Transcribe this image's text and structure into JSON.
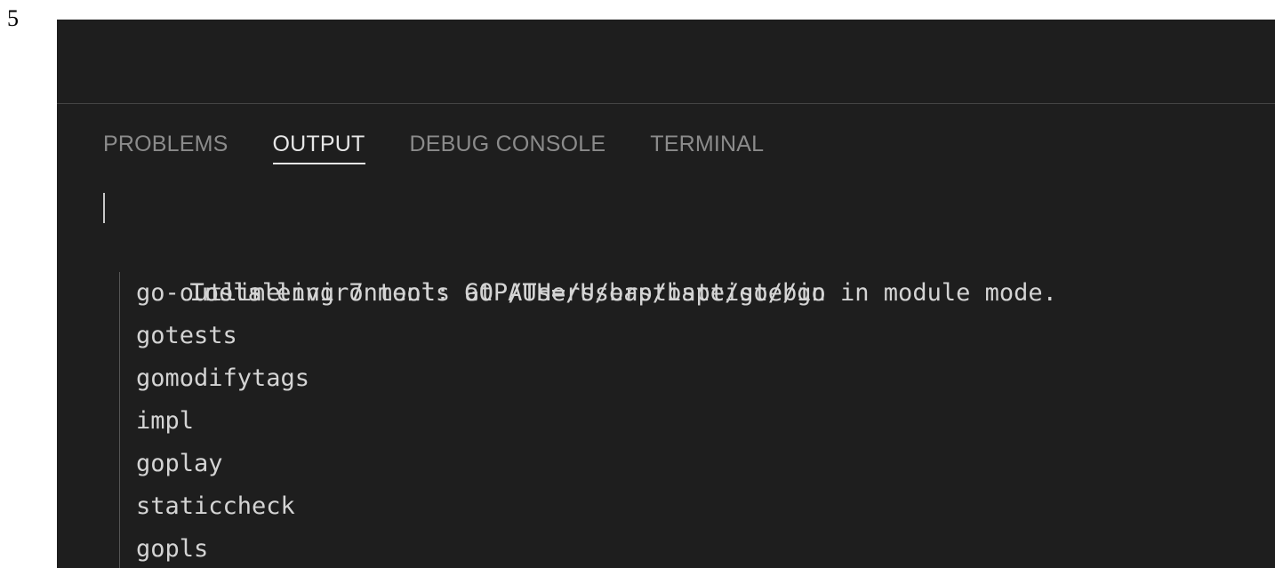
{
  "page_number": "5",
  "tabs": [
    {
      "label": "PROBLEMS",
      "active": false
    },
    {
      "label": "OUTPUT",
      "active": true
    },
    {
      "label": "DEBUG CONSOLE",
      "active": false
    },
    {
      "label": "TERMINAL",
      "active": false
    }
  ],
  "output": {
    "line1": "Tools environment: GOPATH=/Users/baptiste/go",
    "line2": "Installing 7 tools at /Users/baptiste/go/bin in module mode.",
    "tools": [
      "go-outline",
      "gotests",
      "gomodifytags",
      "impl",
      "goplay",
      "staticcheck",
      "gopls"
    ]
  },
  "colors": {
    "panel_background": "#1e1e1e",
    "active_tab": "#e7e7e7",
    "inactive_tab": "#8b8b8b",
    "text": "#d4d4d4"
  }
}
